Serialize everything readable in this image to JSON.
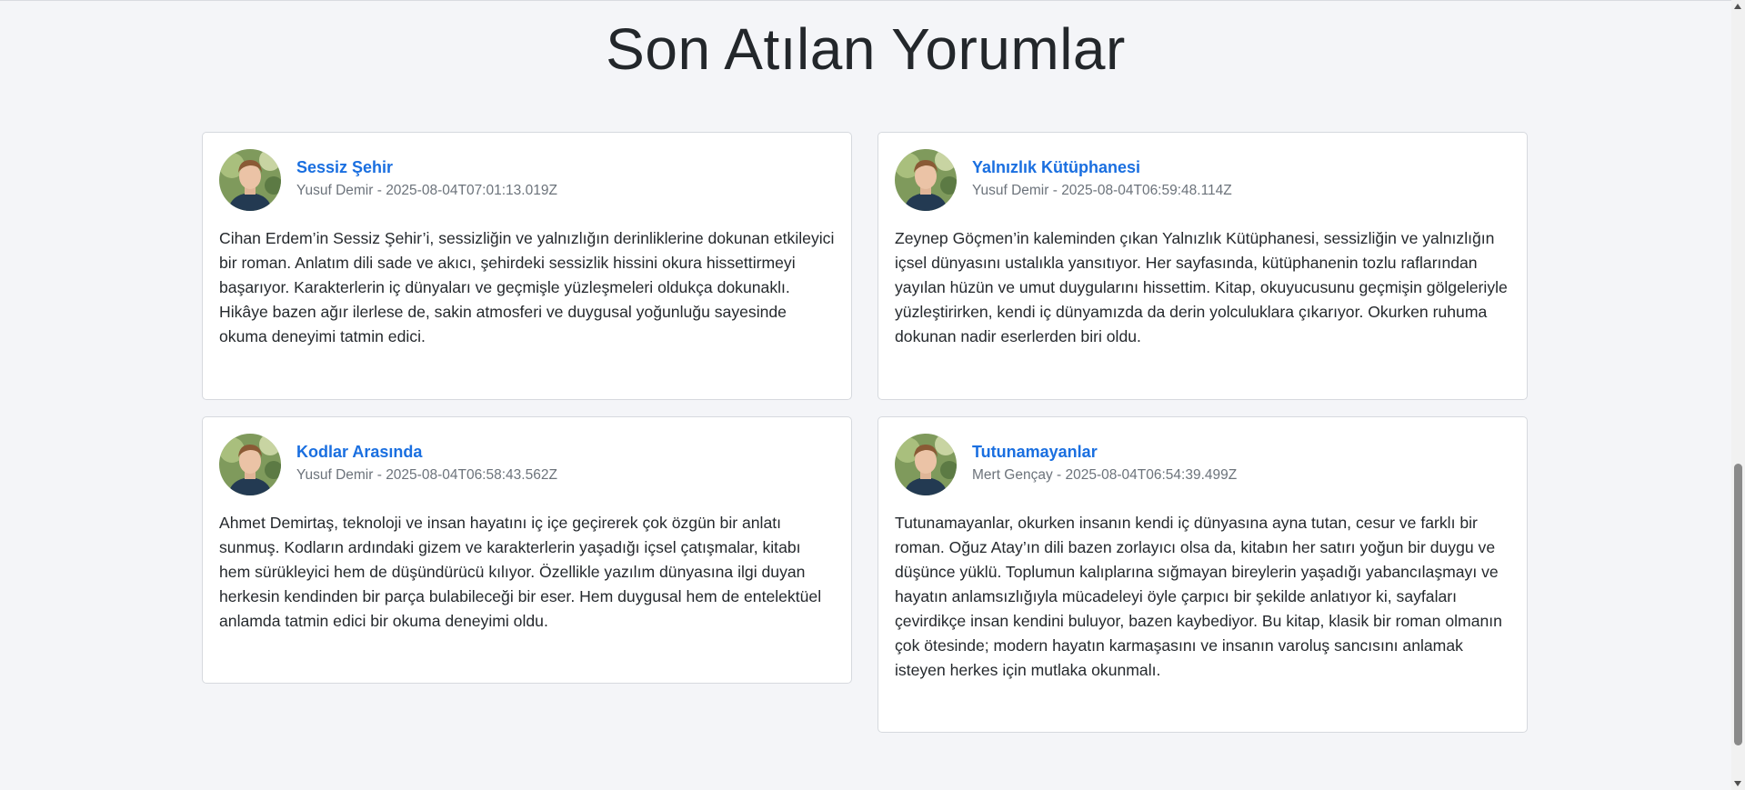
{
  "page_title": "Son Atılan Yorumlar",
  "reviews": [
    {
      "book_title": "Sessiz Şehir",
      "meta": "Yusuf Demir - 2025-08-04T07:01:13.019Z",
      "text": "Cihan Erdem’in Sessiz Şehir’i, sessizliğin ve yalnızlığın derinliklerine dokunan etkileyici bir roman. Anlatım dili sade ve akıcı, şehirdeki sessizlik hissini okura hissettirmeyi başarıyor. Karakterlerin iç dünyaları ve geçmişle yüzleşmeleri oldukça dokunaklı. Hikâye bazen ağır ilerlese de, sakin atmosferi ve duygusal yoğunluğu sayesinde okuma deneyimi tatmin edici."
    },
    {
      "book_title": "Yalnızlık Kütüphanesi",
      "meta": "Yusuf Demir - 2025-08-04T06:59:48.114Z",
      "text": "Zeynep Göçmen’in kaleminden çıkan Yalnızlık Kütüphanesi, sessizliğin ve yalnızlığın içsel dünyasını ustalıkla yansıtıyor. Her sayfasında, kütüphanenin tozlu raflarından yayılan hüzün ve umut duygularını hissettim. Kitap, okuyucusunu geçmişin gölgeleriyle yüzleştirirken, kendi iç dünyamızda da derin yolculuklara çıkarıyor. Okurken ruhuma dokunan nadir eserlerden biri oldu."
    },
    {
      "book_title": "Kodlar Arasında",
      "meta": "Yusuf Demir - 2025-08-04T06:58:43.562Z",
      "text": "Ahmet Demirtaş, teknoloji ve insan hayatını iç içe geçirerek çok özgün bir anlatı sunmuş. Kodların ardındaki gizem ve karakterlerin yaşadığı içsel çatışmalar, kitabı hem sürükleyici hem de düşündürücü kılıyor. Özellikle yazılım dünyasına ilgi duyan herkesin kendinden bir parça bulabileceği bir eser. Hem duygusal hem de entelektüel anlamda tatmin edici bir okuma deneyimi oldu."
    },
    {
      "book_title": "Tutunamayanlar",
      "meta": "Mert Gençay - 2025-08-04T06:54:39.499Z",
      "text": "Tutunamayanlar, okurken insanın kendi iç dünyasına ayna tutan, cesur ve farklı bir roman. Oğuz Atay’ın dili bazen zorlayıcı olsa da, kitabın her satırı yoğun bir duygu ve düşünce yüklü. Toplumun kalıplarına sığmayan bireylerin yaşadığı yabancılaşmayı ve hayatın anlamsızlığıyla mücadeleyi öyle çarpıcı bir şekilde anlatıyor ki, sayfaları çevirdikçe insan kendini buluyor, bazen kaybediyor. Bu kitap, klasik bir roman olmanın çok ötesinde; modern hayatın karmaşasını ve insanın varoluş sancısını anlamak isteyen herkes için mutlaka okunmalı."
    }
  ],
  "colors": {
    "background": "#f4f5f8",
    "link": "#1a6fe0",
    "meta": "#6c737b",
    "card_border": "#d6d9de"
  },
  "icons": {
    "avatar": "user-avatar",
    "scroll_up": "scroll-up-arrow",
    "scroll_down": "scroll-down-arrow"
  }
}
